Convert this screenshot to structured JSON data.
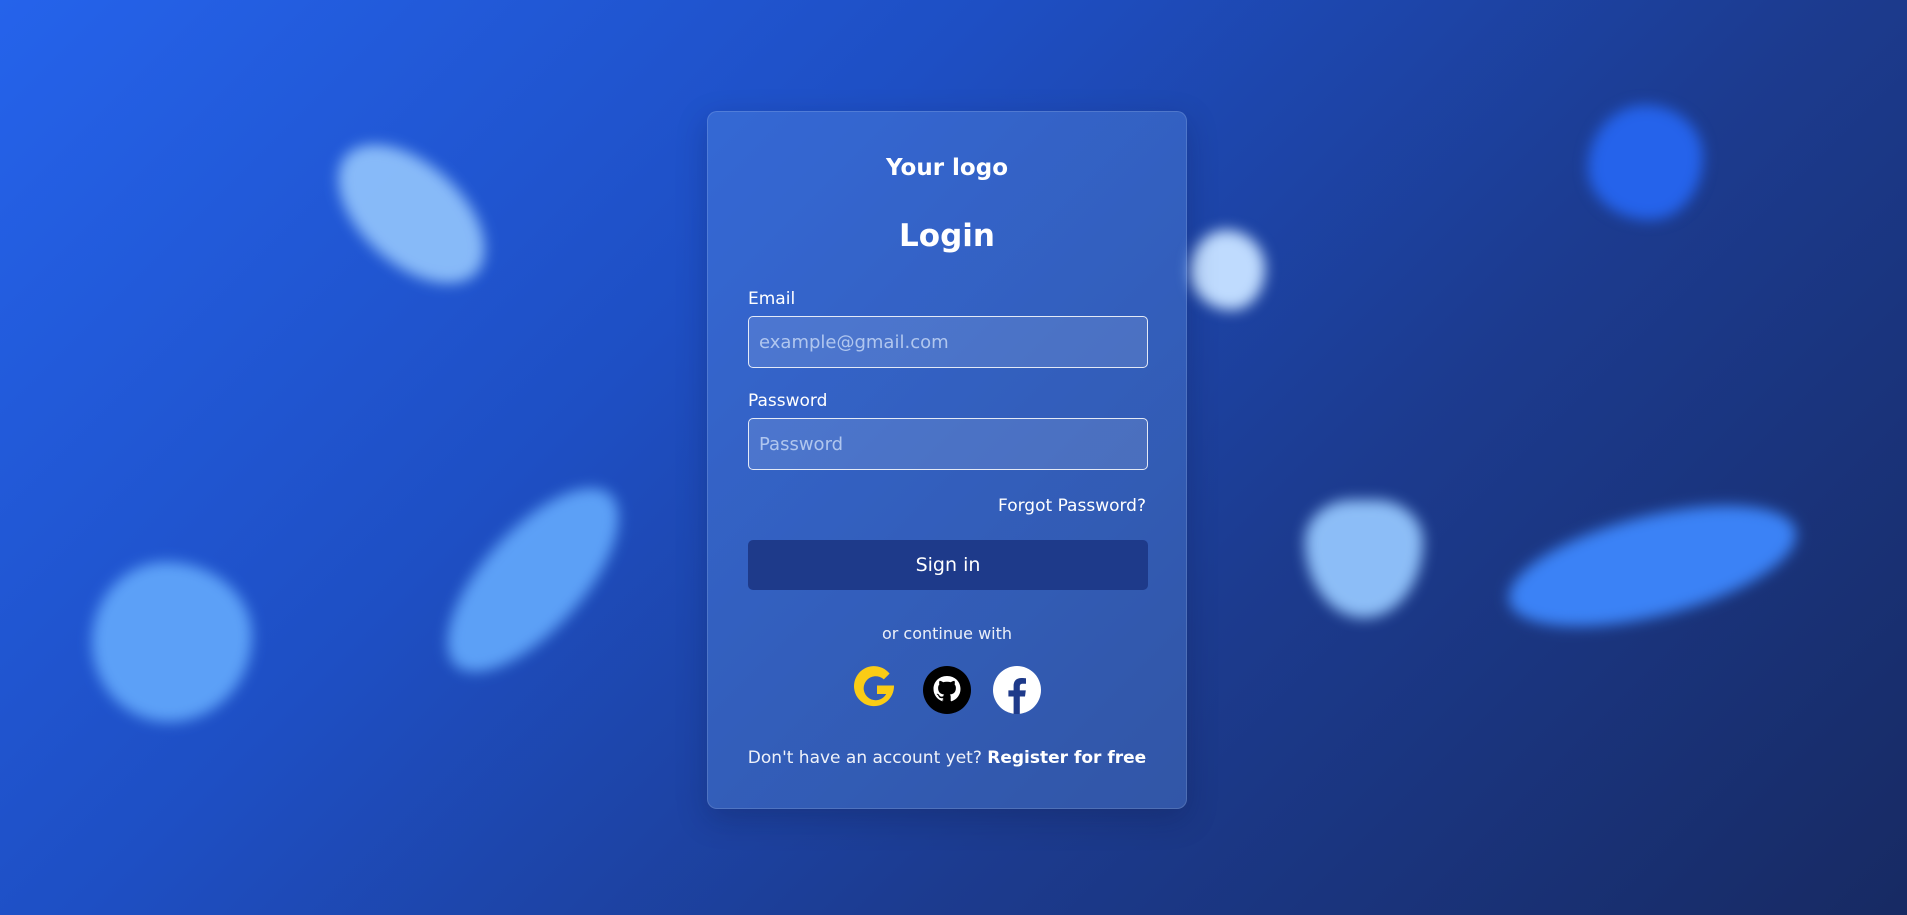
{
  "brand": {
    "logo_text": "Your logo"
  },
  "login": {
    "title": "Login",
    "email": {
      "label": "Email",
      "placeholder": "example@gmail.com",
      "value": ""
    },
    "password": {
      "label": "Password",
      "placeholder": "Password",
      "value": ""
    },
    "forgot_password": "Forgot Password?",
    "sign_in_label": "Sign in",
    "divider_text": "or continue with",
    "social_providers": [
      {
        "name": "Google",
        "icon": "google-icon",
        "color": "#facc15"
      },
      {
        "name": "GitHub",
        "icon": "github-icon",
        "color": "#000000"
      },
      {
        "name": "Facebook",
        "icon": "facebook-icon",
        "color": "#ffffff"
      }
    ],
    "register_prompt": "Don't have an account yet?",
    "register_link": "Register for free"
  },
  "colors": {
    "background_start": "#2563eb",
    "background_end": "#172a63",
    "button": "#1e3a8a",
    "text": "#ffffff"
  }
}
